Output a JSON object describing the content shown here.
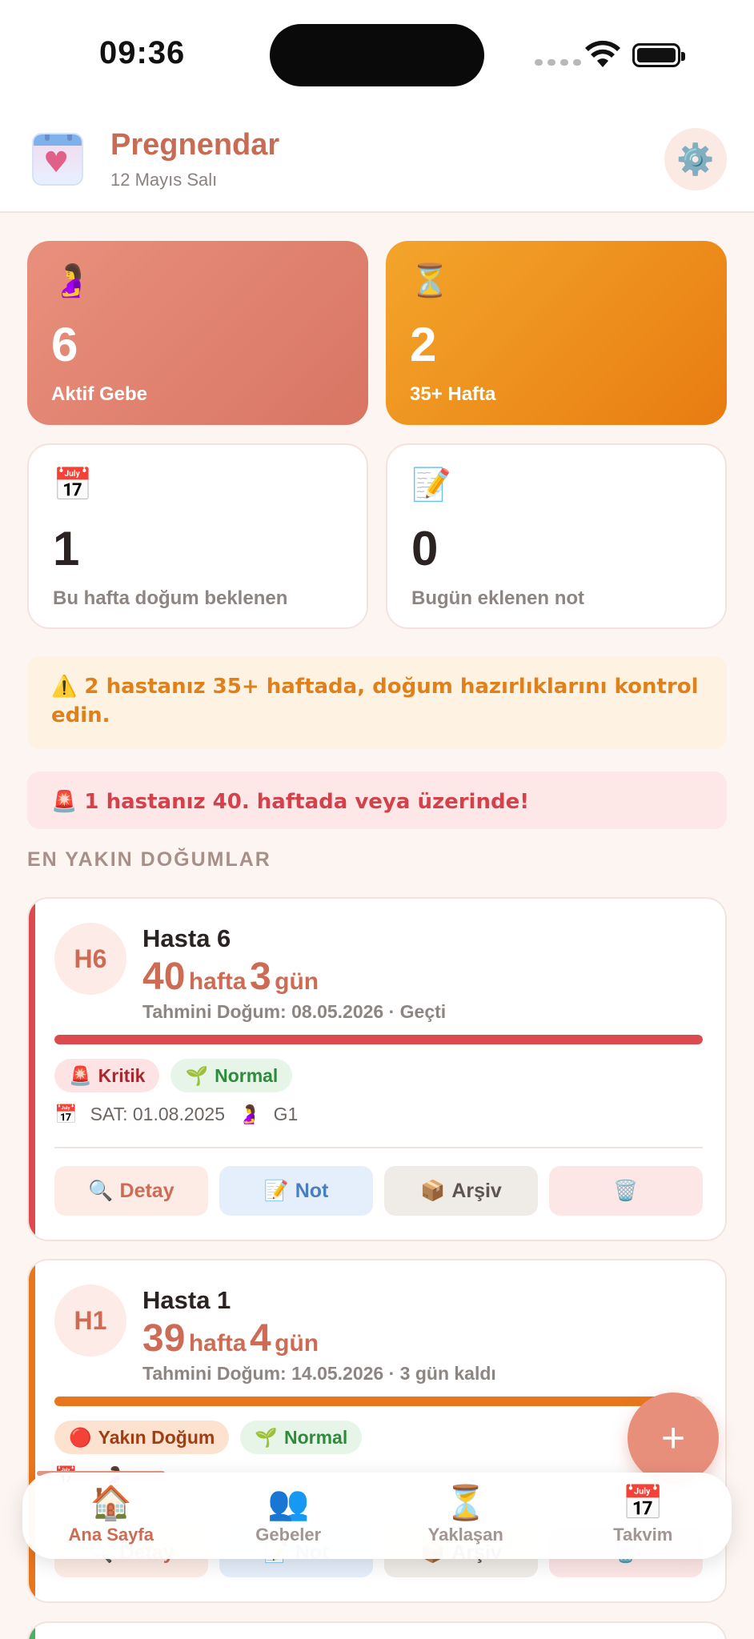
{
  "status_bar": {
    "time": "09:36"
  },
  "header": {
    "app_name": "Pregnendar",
    "date": "12 Mayıs Salı"
  },
  "stats": [
    {
      "icon": "🤰",
      "value": "6",
      "label": "Aktif Gebe"
    },
    {
      "icon": "⏳",
      "value": "2",
      "label": "35+ Hafta"
    },
    {
      "icon": "📅",
      "value": "1",
      "label": "Bu hafta doğum beklenen"
    },
    {
      "icon": "📝",
      "value": "0",
      "label": "Bugün eklenen not"
    }
  ],
  "alerts": {
    "warning": "⚠️ 2 hastanız 35+ haftada, doğum hazırlıklarını kontrol edin.",
    "critical": "🚨 1 hastanız 40. haftada veya üzerinde!"
  },
  "section_title": "EN YAKIN DOĞUMLAR",
  "patients": [
    {
      "initials": "H6",
      "name": "Hasta 6",
      "weeks": "40",
      "weeks_unit": "hafta",
      "days": "3",
      "days_unit": "gün",
      "due": "Tahmini Doğum: 08.05.2026 · Geçti",
      "progress": 1.0,
      "color": "#dc4a4f",
      "tags": [
        {
          "icon": "🚨",
          "label": "Kritik",
          "kind": "critical"
        },
        {
          "icon": "🌱",
          "label": "Normal",
          "kind": "normal"
        }
      ],
      "lmp_icon": "📅",
      "lmp": "SAT: 01.08.2025",
      "gravida_icon": "🤰",
      "gravida": "G1",
      "actions": {
        "detail": "Detay",
        "note": "Not",
        "archive": "Arşiv"
      }
    },
    {
      "initials": "H1",
      "name": "Hasta 1",
      "weeks": "39",
      "weeks_unit": "hafta",
      "days": "4",
      "days_unit": "gün",
      "due": "Tahmini Doğum: 14.05.2026 · 3 gün kaldı",
      "progress": 0.99,
      "color": "#e8761c",
      "tags": [
        {
          "icon": "🔴",
          "label": "Yakın Doğum",
          "kind": "near"
        },
        {
          "icon": "🌱",
          "label": "Normal",
          "kind": "normal"
        }
      ],
      "lmp_icon": "📅",
      "lmp": "",
      "gravida_icon": "🤰",
      "gravida": "",
      "actions": {
        "detail": "Detay",
        "note": "Not",
        "archive": "Arşiv"
      }
    }
  ],
  "icons": {
    "detail": "🔍",
    "note": "📝",
    "archive": "📦",
    "delete": "🗑️",
    "settings": "⚙️",
    "fab": "+"
  },
  "colors": {
    "brand": "#cd6b54",
    "warning": "#e0801a",
    "critical": "#d4414a"
  },
  "nav": [
    {
      "icon": "🏠",
      "label": "Ana Sayfa",
      "active": true
    },
    {
      "icon": "👥",
      "label": "Gebeler",
      "active": false
    },
    {
      "icon": "⏳",
      "label": "Yaklaşan",
      "active": false
    },
    {
      "icon": "📅",
      "label": "Takvim",
      "active": false
    }
  ]
}
